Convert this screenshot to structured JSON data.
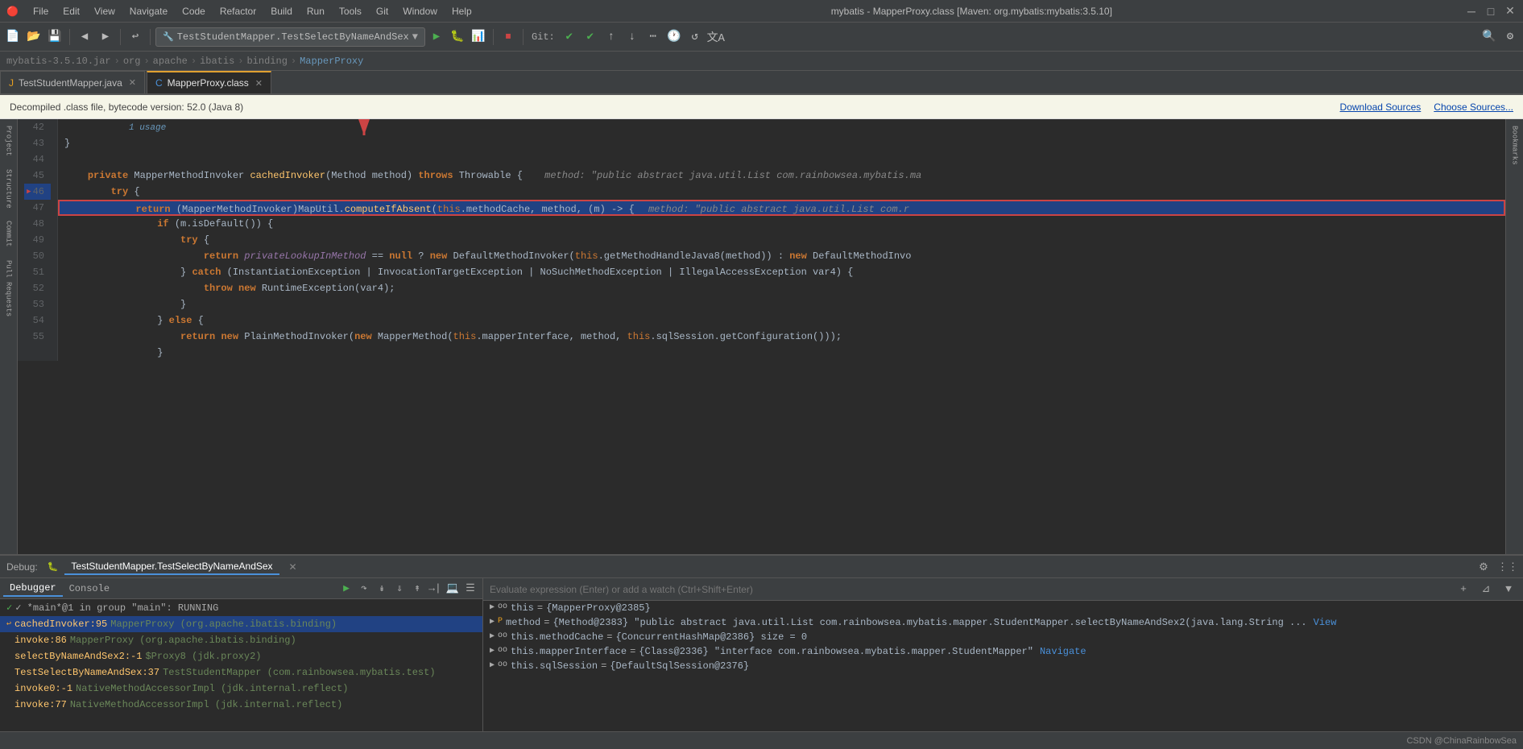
{
  "app": {
    "title": "mybatis - MapperProxy.class [Maven: org.mybatis:mybatis:3.5.10]",
    "logo": "🔴"
  },
  "menu": {
    "items": [
      "File",
      "Edit",
      "View",
      "Navigate",
      "Code",
      "Refactor",
      "Build",
      "Run",
      "Tools",
      "Git",
      "Window",
      "Help"
    ]
  },
  "toolbar": {
    "run_config": "TestStudentMapper.TestSelectByNameAndSex",
    "git_label": "Git:"
  },
  "breadcrumb": {
    "parts": [
      "mybatis-3.5.10.jar",
      "org",
      "apache",
      "ibatis",
      "binding",
      "MapperProxy"
    ]
  },
  "tabs": [
    {
      "label": "TestStudentMapper.java",
      "type": "java",
      "active": false
    },
    {
      "label": "MapperProxy.class",
      "type": "class",
      "active": true
    }
  ],
  "notification": {
    "text": "Decompiled .class file, bytecode version: 52.0 (Java 8)",
    "links": [
      "Download Sources",
      "Choose Sources..."
    ]
  },
  "code_lines": [
    {
      "num": 42,
      "text": "    }",
      "highlight": false
    },
    {
      "num": 43,
      "text": "",
      "highlight": false
    },
    {
      "num": 44,
      "text": "    private MapperMethodInvoker cachedInvoker(Method method) throws Throwable {",
      "highlight": false,
      "annotation": "method: \"public abstract java.util.List com.rainbowsea.mybatis.ma"
    },
    {
      "num": 45,
      "text": "        try {",
      "highlight": false
    },
    {
      "num": 46,
      "text": "            return (MapperMethodInvoker)MapUtil.computeIfAbsent(this.methodCache, method, (m) -> {",
      "highlight": true,
      "annotation": "method: \"public abstract java.util.List com.r"
    },
    {
      "num": 47,
      "text": "                if (m.isDefault()) {",
      "highlight": false
    },
    {
      "num": 48,
      "text": "                    try {",
      "highlight": false
    },
    {
      "num": 49,
      "text": "                        return privateLookupInMethod == null ? new DefaultMethodInvoker(this.getMethodHandleJava8(method)) : new DefaultMethodInvo",
      "highlight": false
    },
    {
      "num": 50,
      "text": "                    } catch (InstantiationException | InvocationTargetException | NoSuchMethodException | IllegalAccessException var4) {",
      "highlight": false
    },
    {
      "num": 51,
      "text": "                        throw new RuntimeException(var4);",
      "highlight": false
    },
    {
      "num": 52,
      "text": "                    }",
      "highlight": false
    },
    {
      "num": 53,
      "text": "                } else {",
      "highlight": false
    },
    {
      "num": 54,
      "text": "                    return new PlainMethodInvoker(new MapperMethod(this.mapperInterface, method, this.sqlSession.getConfiguration()));",
      "highlight": false
    },
    {
      "num": 55,
      "text": "                }",
      "highlight": false
    }
  ],
  "debug": {
    "title": "Debug:",
    "session_tab": "TestStudentMapper.TestSelectByNameAndSex",
    "threads": [
      {
        "label": "✓ *main*@1 in group \"main\": RUNNING",
        "type": "running"
      }
    ],
    "stack_frames": [
      {
        "name": "cachedInvoker:95",
        "class": "MapperProxy (org.apache.ibatis.binding)",
        "selected": true
      },
      {
        "name": "invoke:86",
        "class": "MapperProxy (org.apache.ibatis.binding)",
        "selected": false
      },
      {
        "name": "selectByNameAndSex2:-1",
        "class": "$Proxy8 (jdk.proxy2)",
        "selected": false
      },
      {
        "name": "TestSelectByNameAndSex:37",
        "class": "TestStudentMapper (com.rainbowsea.mybatis.test)",
        "selected": false
      },
      {
        "name": "invoke0:-1",
        "class": "NativeMethodAccessorImpl (jdk.internal.reflect)",
        "selected": false
      },
      {
        "name": "invoke:77",
        "class": "NativeMethodAccessorImpl (jdk.internal.reflect)",
        "selected": false
      }
    ]
  },
  "variables": {
    "watch_placeholder": "Evaluate expression (Enter) or add a watch (Ctrl+Shift+Enter)",
    "items": [
      {
        "name": "this",
        "value": "{MapperProxy@2385}",
        "type": "object",
        "expandable": true
      },
      {
        "name": "method",
        "value": "{Method@2383} \"public abstract java.util.List com.rainbowsea.mybatis.mapper.StudentMapper.selectByNameAndSex2(java.lang.String ...",
        "type": "object",
        "expandable": true,
        "link": "View"
      },
      {
        "name": "this.methodCache",
        "value": "{ConcurrentHashMap@2386}  size = 0",
        "type": "object",
        "expandable": true
      },
      {
        "name": "this.mapperInterface",
        "value": "{Class@2336} \"interface com.rainbowsea.mybatis.mapper.StudentMapper\"",
        "type": "object",
        "expandable": true,
        "link": "Navigate"
      },
      {
        "name": "this.sqlSession",
        "value": "{DefaultSqlSession@2376}",
        "type": "object",
        "expandable": true
      }
    ]
  },
  "status": {
    "watermark": "CSDN @ChinaRainbowSea"
  },
  "icons": {
    "project_icon": "📁",
    "structure_icon": "🏗",
    "commit_icon": "✔",
    "pull_requests_icon": "⬆",
    "bookmarks_icon": "🔖",
    "play_icon": "▶",
    "debug_icon": "🐛",
    "gear_icon": "⚙",
    "close_icon": "✕",
    "chevron_down": "▼",
    "chevron_right": "▶",
    "arrow_left": "←",
    "arrow_right": "→",
    "thread_icon": "⟳",
    "frame_icon": "⬛"
  }
}
